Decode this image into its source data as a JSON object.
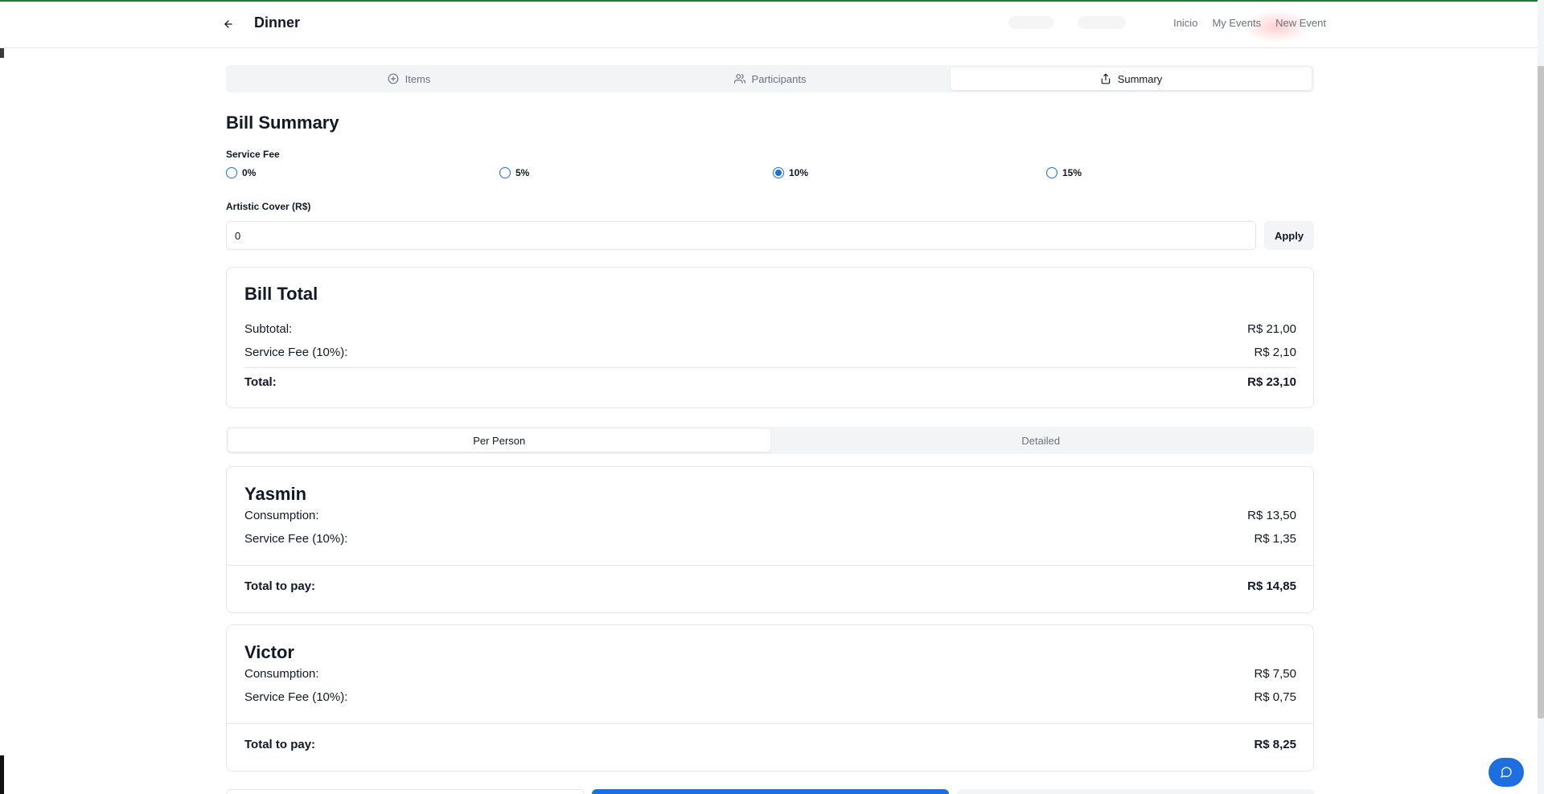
{
  "header": {
    "title": "Dinner",
    "nav": [
      "Inicio",
      "My Events",
      "New Event"
    ]
  },
  "tabs": [
    {
      "label": "Items",
      "icon": "plus-circle-icon",
      "active": false
    },
    {
      "label": "Participants",
      "icon": "users-icon",
      "active": false
    },
    {
      "label": "Summary",
      "icon": "share-icon",
      "active": true
    }
  ],
  "summary": {
    "title": "Bill Summary",
    "service_fee_label": "Service Fee",
    "fee_options": [
      {
        "label": "0%",
        "checked": false
      },
      {
        "label": "5%",
        "checked": false
      },
      {
        "label": "10%",
        "checked": true
      },
      {
        "label": "15%",
        "checked": false
      }
    ],
    "artistic_cover_label": "Artistic Cover (R$)",
    "artistic_cover_value": "0",
    "apply_label": "Apply"
  },
  "bill_total": {
    "title": "Bill Total",
    "subtotal_label": "Subtotal:",
    "subtotal_value": "R$ 21,00",
    "fee_label": "Service Fee (10%):",
    "fee_value": "R$ 2,10",
    "total_label": "Total:",
    "total_value": "R$ 23,10"
  },
  "view_tabs": [
    {
      "label": "Per Person",
      "active": true
    },
    {
      "label": "Detailed",
      "active": false
    }
  ],
  "people": [
    {
      "name": "Yasmin",
      "consumption_label": "Consumption:",
      "consumption_value": "R$ 13,50",
      "fee_label": "Service Fee (10%):",
      "fee_value": "R$ 1,35",
      "total_label": "Total to pay:",
      "total_value": "R$ 14,85"
    },
    {
      "name": "Victor",
      "consumption_label": "Consumption:",
      "consumption_value": "R$ 7,50",
      "fee_label": "Service Fee (10%):",
      "fee_value": "R$ 0,75",
      "total_label": "Total to pay:",
      "total_value": "R$ 8,25"
    }
  ],
  "colors": {
    "accent": "#1d6fe0",
    "muted_text": "#6b7280",
    "border": "#e5e7eb"
  }
}
